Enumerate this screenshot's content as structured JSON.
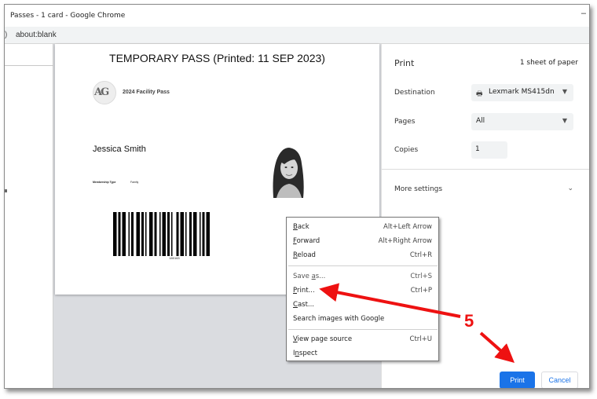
{
  "window": {
    "title": "Passes - 1 card - Google Chrome",
    "minimize_glyph": "–"
  },
  "addressbar": {
    "icon": "info-icon",
    "url": "about:blank"
  },
  "pass": {
    "title": "TEMPORARY PASS (Printed: 11 SEP 2023)",
    "logo_text": "AG",
    "facility": "2024 Facility Pass",
    "name": "Jessica Smith",
    "membership_label": "Membership Type",
    "membership_value": "Family",
    "barcode_number": "180163"
  },
  "print_panel": {
    "heading": "Print",
    "sheets": "1 sheet of paper",
    "destination_label": "Destination",
    "destination_value": "Lexmark MS415dn",
    "destination_icon": "printer-icon",
    "pages_label": "Pages",
    "pages_value": "All",
    "copies_label": "Copies",
    "copies_value": "1",
    "more_settings": "More settings",
    "print_button": "Print",
    "cancel_button": "Cancel"
  },
  "context_menu": {
    "items": [
      {
        "label": "Back",
        "shortcut": "Alt+Left Arrow"
      },
      {
        "label": "Forward",
        "shortcut": "Alt+Right Arrow"
      },
      {
        "label": "Reload",
        "shortcut": "Ctrl+R"
      },
      {
        "label": "Save as...",
        "shortcut": "Ctrl+S"
      },
      {
        "label": "Print...",
        "shortcut": "Ctrl+P"
      },
      {
        "label": "Cast...",
        "shortcut": ""
      },
      {
        "label": "Search images with Google",
        "shortcut": ""
      },
      {
        "label": "View page source",
        "shortcut": "Ctrl+U"
      },
      {
        "label": "Inspect",
        "shortcut": ""
      }
    ]
  },
  "annotation": {
    "step": "5",
    "color": "#ee1111"
  }
}
